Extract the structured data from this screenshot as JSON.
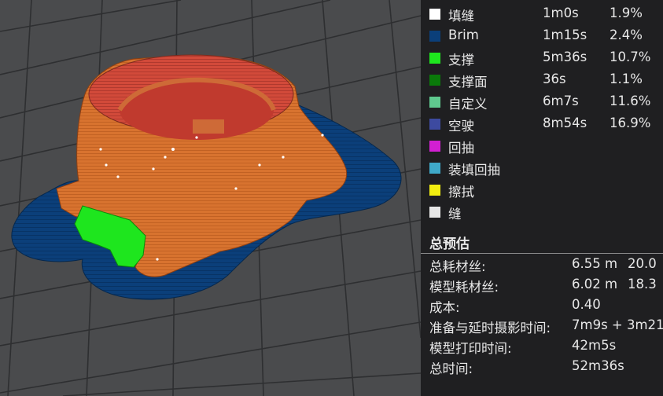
{
  "legend": {
    "items": [
      {
        "name": "填缝",
        "time": "1m0s",
        "pct": "1.9%",
        "color": "#ffffff"
      },
      {
        "name": "Brim",
        "time": "1m15s",
        "pct": "2.4%",
        "color": "#0b3f7a"
      },
      {
        "name": "支撑",
        "time": "5m36s",
        "pct": "10.7%",
        "color": "#1ee61e"
      },
      {
        "name": "支撑面",
        "time": "36s",
        "pct": "1.1%",
        "color": "#0a7a0a"
      },
      {
        "name": "自定义",
        "time": "6m7s",
        "pct": "11.6%",
        "color": "#5fc98e"
      },
      {
        "name": "空驶",
        "time": "8m54s",
        "pct": "16.9%",
        "color": "#3d4aa0"
      },
      {
        "name": "回抽",
        "time": "",
        "pct": "",
        "color": "#d21fd2"
      },
      {
        "name": "装填回抽",
        "time": "",
        "pct": "",
        "color": "#3fa9c9"
      },
      {
        "name": "擦拭",
        "time": "",
        "pct": "",
        "color": "#f2ee10"
      },
      {
        "name": "缝",
        "time": "",
        "pct": "",
        "color": "#e6e6e6"
      }
    ]
  },
  "summary": {
    "title": "总预估",
    "rows": [
      {
        "label": "总耗材丝:",
        "v1": "6.55 m",
        "v2": "20.0"
      },
      {
        "label": "模型耗材丝:",
        "v1": "6.02 m",
        "v2": "18.3"
      },
      {
        "label": "成本:",
        "v1": "0.40",
        "v2": ""
      },
      {
        "label": "准备与延时摄影时间:",
        "v1": "7m9s + 3m21",
        "v2": ""
      },
      {
        "label": "模型打印时间:",
        "v1": "42m5s",
        "v2": ""
      },
      {
        "label": "总时间:",
        "v1": "52m36s",
        "v2": ""
      }
    ]
  },
  "colors": {
    "model": "#d8732f",
    "model_top": "#d24a3a",
    "brim": "#0b3f7a",
    "support": "#1ee61e",
    "bed": "#4a4b4d",
    "grid": "#2e2f31"
  }
}
